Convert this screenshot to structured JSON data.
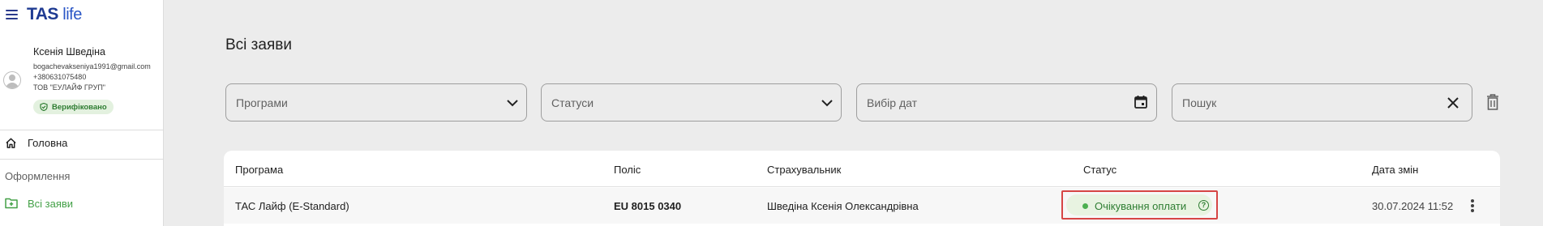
{
  "app": {
    "logo_main": "TAS",
    "logo_sub": "life"
  },
  "user": {
    "name": "Ксенія Шведіна",
    "email": "bogachevakseniya1991@gmail.com",
    "phone": "+380631075480",
    "company": "ТОВ \"ЕУЛАЙФ ГРУП\"",
    "verified_label": "Верифіковано"
  },
  "nav": {
    "home_label": "Головна",
    "section_label": "Оформлення",
    "all_requests_label": "Всі заяви"
  },
  "page": {
    "title": "Всі заяви"
  },
  "filters": {
    "programs_placeholder": "Програми",
    "statuses_placeholder": "Статуси",
    "dates_placeholder": "Вибір дат",
    "search_placeholder": "Пошук"
  },
  "table": {
    "columns": [
      "Програма",
      "Поліс",
      "Страхувальник",
      "Статус",
      "Дата змін"
    ],
    "rows": [
      {
        "program": "ТАС Лайф (E-Standard)",
        "policy": "EU 8015 0340",
        "insurer": "Шведіна Ксенія Олександрівна",
        "status": "Очікування оплати",
        "date": "30.07.2024 11:52"
      }
    ]
  },
  "colors": {
    "brand": "#1f3b92",
    "accent_green": "#43a047",
    "status_green": "#2e7d32",
    "highlight_red": "#d64545"
  },
  "icons": {
    "menu": "menu-icon",
    "home": "home-icon",
    "folder": "folder-add-icon",
    "calendar": "calendar-icon",
    "close": "close-icon",
    "trash": "trash-icon",
    "more": "more-vertical-icon",
    "help": "help-circle-icon"
  }
}
